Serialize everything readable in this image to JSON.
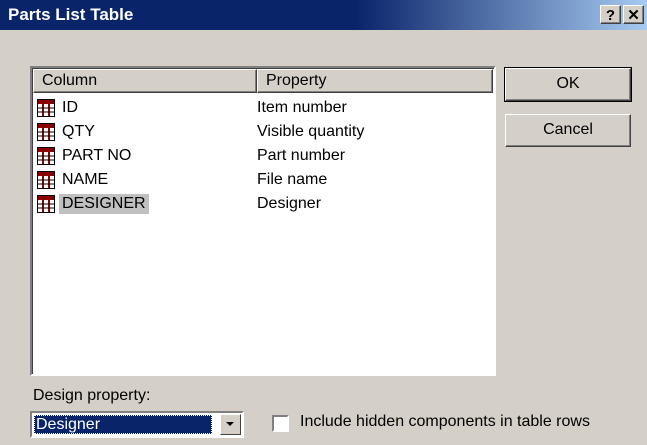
{
  "window": {
    "title": "Parts List Table",
    "help_label": "?",
    "close_label": "✕"
  },
  "list": {
    "headers": [
      "Column",
      "Property"
    ],
    "rows": [
      {
        "column": "ID",
        "property": "Item number"
      },
      {
        "column": "QTY",
        "property": "Visible quantity"
      },
      {
        "column": "PART NO",
        "property": "Part number"
      },
      {
        "column": "NAME",
        "property": "File name"
      },
      {
        "column": "DESIGNER",
        "property": "Designer",
        "selected": true
      }
    ],
    "row_icon": "table-column-icon"
  },
  "buttons": {
    "ok": "OK",
    "cancel": "Cancel"
  },
  "design_property": {
    "label": "Design property:",
    "value": "Designer"
  },
  "include_hidden": {
    "label": "Include hidden components in table rows",
    "checked": false
  },
  "colors": {
    "title_bar": "#0a246a",
    "face": "#d4d0c8",
    "selection": "#0a246a",
    "icon": "#8b0000"
  }
}
